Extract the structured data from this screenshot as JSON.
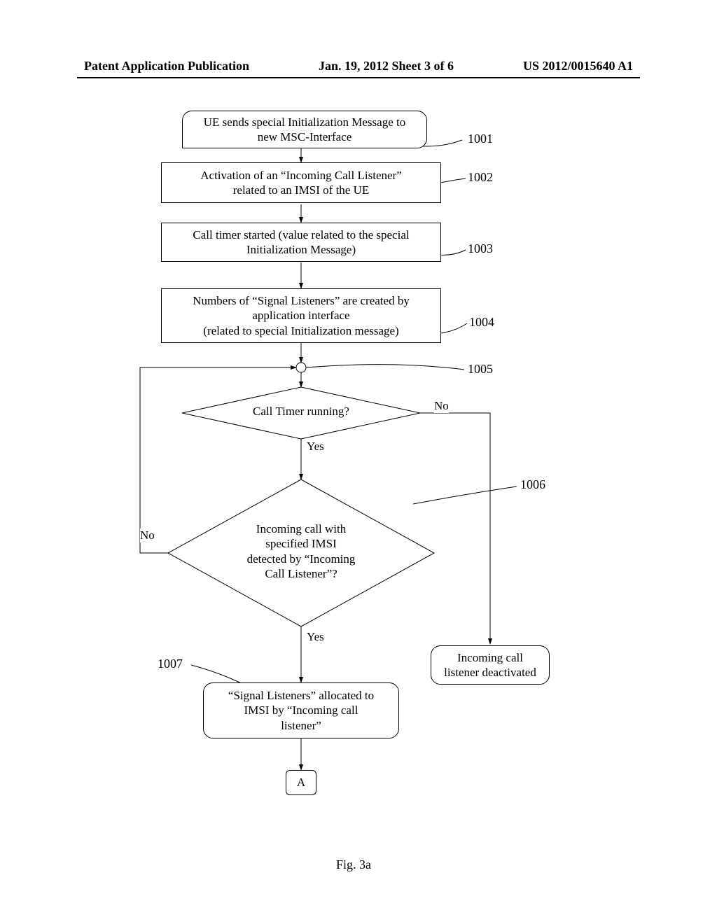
{
  "header": {
    "left": "Patent Application Publication",
    "center": "Jan. 19, 2012  Sheet 3 of 6",
    "right": "US 2012/0015640 A1"
  },
  "flow": {
    "step1001": "UE sends special Initialization Message to\nnew MSC-Interface",
    "step1002": "Activation of an “Incoming Call Listener”\nrelated to an IMSI of the UE",
    "step1003": "Call timer started (value related to the special\nInitialization Message)",
    "step1004": "Numbers of “Signal Listeners” are created by\napplication interface\n(related to special Initialization message)",
    "dec1005": "Call Timer running?",
    "dec1006": "Incoming call with\nspecified IMSI\ndetected by “Incoming\nCall Listener”?",
    "deact": "Incoming call\nlistener deactivated",
    "step1007": "“Signal Listeners” allocated to\nIMSI by “Incoming call\nlistener”",
    "connA": "A",
    "labels": {
      "yes": "Yes",
      "no": "No"
    },
    "refs": {
      "r1001": "1001",
      "r1002": "1002",
      "r1003": "1003",
      "r1004": "1004",
      "r1005": "1005",
      "r1006": "1006",
      "r1007": "1007"
    }
  },
  "caption": "Fig. 3a"
}
